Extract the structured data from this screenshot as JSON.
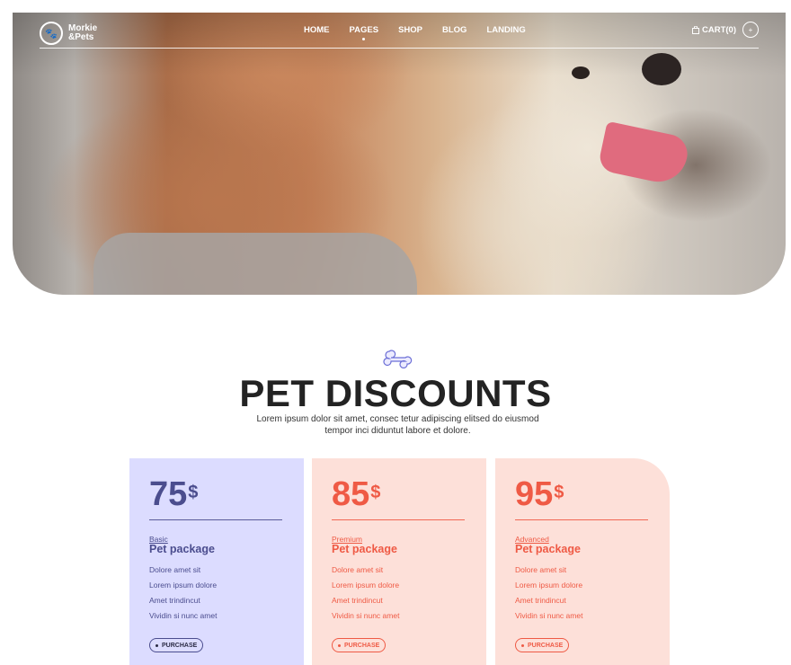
{
  "nav": {
    "logo_line1": "Morkie",
    "logo_line2": "&Pets",
    "items": [
      {
        "label": "HOME"
      },
      {
        "label": "PAGES"
      },
      {
        "label": "SHOP"
      },
      {
        "label": "BLOG"
      },
      {
        "label": "LANDING"
      }
    ],
    "cart_label": "CART(0)",
    "plus_label": "+"
  },
  "section": {
    "title": "PET DISCOUNTS",
    "subtitle": "Lorem ipsum dolor sit amet, consec tetur adipiscing elitsed do eiusmod tempor inci diduntut labore et dolore."
  },
  "plans": [
    {
      "price": "75",
      "currency": "$",
      "tier": "Basic",
      "name": "Pet package",
      "features": [
        "Dolore amet sit",
        "Lorem ipsum dolore",
        "Amet trindincut",
        "Vividin si nunc amet"
      ],
      "button": "PURCHASE"
    },
    {
      "price": "85",
      "currency": "$",
      "tier": "Premium",
      "name": "Pet package",
      "features": [
        "Dolore amet sit",
        "Lorem ipsum dolore",
        "Amet trindincut",
        "Vividin si nunc amet"
      ],
      "button": "PURCHASE"
    },
    {
      "price": "95",
      "currency": "$",
      "tier": "Advanced",
      "name": "Pet package",
      "features": [
        "Dolore amet sit",
        "Lorem ipsum dolore",
        "Amet trindincut",
        "Vividin si nunc amet"
      ],
      "button": "PURCHASE"
    }
  ],
  "colors": {
    "basic_bg": "#dcdcff",
    "basic_text": "#4b4d8e",
    "premium_bg": "#fde0d9",
    "premium_text": "#ef5a45",
    "title": "#232323"
  }
}
